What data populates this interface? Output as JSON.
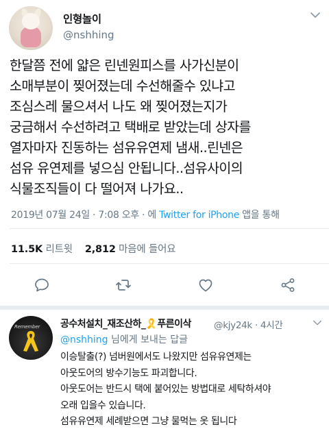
{
  "tweet": {
    "display_name": "인형놀이",
    "handle": "@nshhing",
    "text": "한달쯤 전에 얇은 린넨원피스를 사가신분이\n소매부분이 찢어졌는데 수선해줄수 있냐고\n조심스레 물으셔서 나도 왜 찢어졌는지가\n궁금해서 수선하려고 택배로 받았는데 상자를\n열자마자 진동하는 섬유유연제 냄새..린넨은\n섬유 유연제를 넣으심 안됩니다..섬유사이의\n식물조직들이 다 떨어져 나가요..",
    "date": "2019년 07월 24일 · 7:08 오후 · 에 ",
    "via": "Twitter for iPhone",
    "via_suffix": " 앱을 통해",
    "retweets_count": "11.5K",
    "retweets_label": "리트윗",
    "likes_count": "2,812",
    "likes_label": "마음에 들어요"
  },
  "icons": {
    "reply": "speech-bubble-icon",
    "retweet": "retweet-arrows-icon",
    "like": "heart-icon",
    "share": "share-nodes-icon",
    "more": "chevron-down-icon",
    "accent": "#1da1f2",
    "muted": "#657786"
  },
  "reply": {
    "display_name": "공수처설치_재조산하_🎗️푸른이삭",
    "handle_time": "@kjy24k · 4시간",
    "replying_mention": "@nshhing",
    "replying_suffix": " 님에게 보내는 답글",
    "avatar_text": "Remember",
    "text": "이승탈출(?) 넘버원에서도 나왔지만 섬유유연제는\n아웃도어의 방수기능도 파괴합니다.\n아웃도어는 반드시 택에 붙어있는 방법대로 세탁하셔야\n오래 입을수 있습니다.\n섬유유연제 세례받으면 그냥 물먹는 옷 됩니다"
  }
}
